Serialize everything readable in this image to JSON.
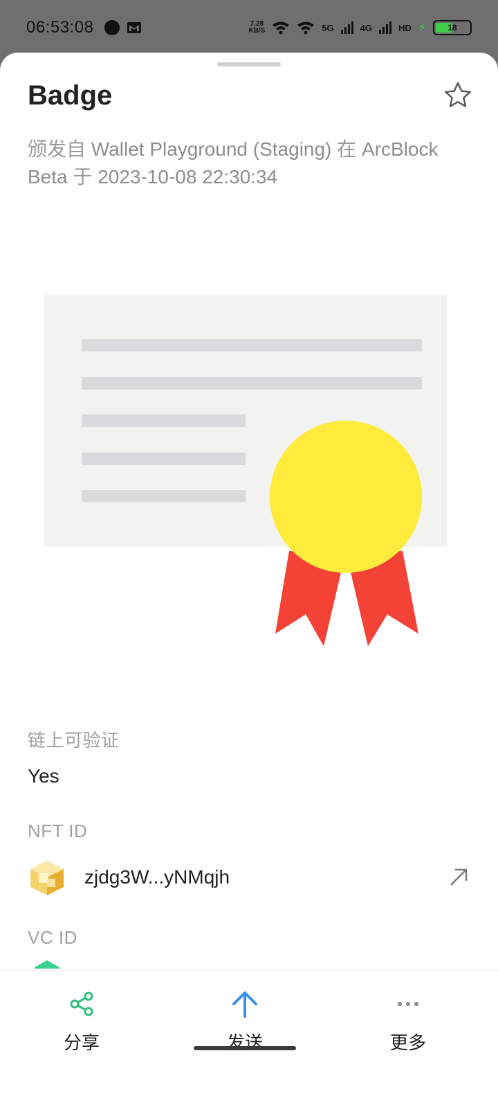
{
  "status_bar": {
    "time": "06:53:08",
    "net_speed_value": "7.28",
    "net_speed_unit": "KB/S",
    "signal1": "5G",
    "signal2": "4G",
    "hd": "HD",
    "battery": "18"
  },
  "sheet": {
    "title": "Badge",
    "issued_prefix": "颁发自",
    "issuer": "Wallet Playground (Staging)",
    "in_word": "在",
    "network": "ArcBlock Beta",
    "at_word": "于",
    "datetime": "2023-10-08 22:30:34"
  },
  "fields": {
    "verifiable_label": "链上可验证",
    "verifiable_value": "Yes",
    "nft_label": "NFT ID",
    "nft_value": "zjdg3W...yNMqjh",
    "vc_label": "VC ID"
  },
  "actions": {
    "share": "分享",
    "send": "发送",
    "more": "更多"
  },
  "colors": {
    "share_accent": "#2fbf7d",
    "send_accent": "#3b8fe8",
    "medal_yellow": "#ffeb3b",
    "ribbon_red": "#f44336"
  }
}
